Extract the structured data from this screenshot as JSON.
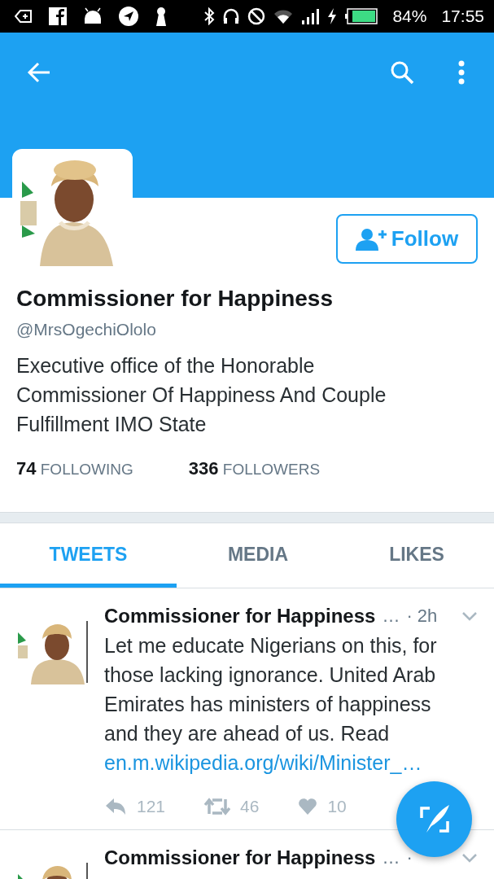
{
  "status_bar": {
    "battery": "84%",
    "time": "17:55"
  },
  "profile": {
    "name": "Commissioner for Happiness",
    "handle": "@MrsOgechiOlolo",
    "bio": "Executive office of the Honorable Commissioner Of Happiness And Couple Fulfillment IMO State",
    "follow_label": "Follow",
    "following_count": "74",
    "following_label": "FOLLOWING",
    "followers_count": "336",
    "followers_label": "FOLLOWERS"
  },
  "tabs": [
    {
      "label": "TWEETS",
      "selected": true
    },
    {
      "label": "MEDIA",
      "selected": false
    },
    {
      "label": "LIKES",
      "selected": false
    }
  ],
  "tweets": [
    {
      "name": "Commissioner for Happiness",
      "handle": "…",
      "time": "· 2h",
      "text": "Let me educate Nigerians on this, for those lacking ignorance. United Arab Emirates has ministers of happiness and they are ahead of us. Read",
      "link": "en.m.wikipedia.org/wiki/Minister_…",
      "replies": "121",
      "retweets": "46",
      "likes": "10"
    },
    {
      "name": "Commissioner for Happiness",
      "handle": "…",
      "time": "·"
    }
  ]
}
